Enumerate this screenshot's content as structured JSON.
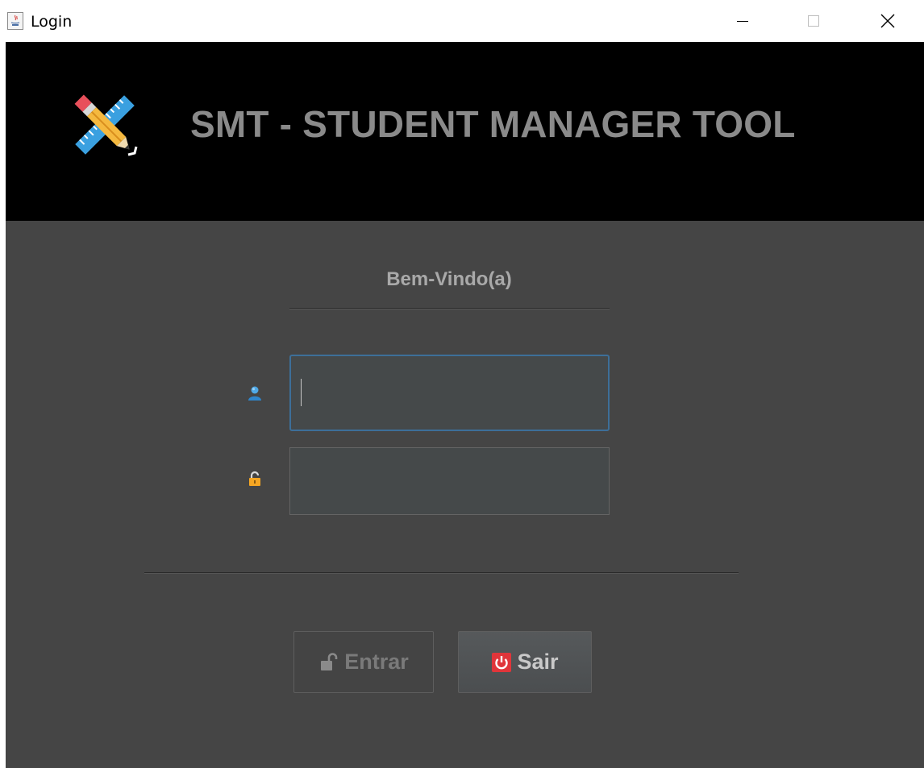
{
  "window": {
    "title": "Login",
    "controls": {
      "minimize_icon": "minimize-icon",
      "maximize_icon": "maximize-icon",
      "close_icon": "close-icon"
    }
  },
  "header": {
    "app_title": "SMT - STUDENT MANAGER TOOL",
    "logo_icon": "ruler-pencil-icon",
    "background": "#000000",
    "title_color": "#8a8a8a"
  },
  "form": {
    "welcome_text": "Bem-Vindo(a)",
    "username": {
      "icon": "user-icon",
      "value": "",
      "placeholder": ""
    },
    "password": {
      "icon": "lock-icon",
      "value": "",
      "placeholder": ""
    }
  },
  "buttons": {
    "enter_label": "Entrar",
    "enter_icon": "unlock-icon",
    "exit_label": "Sair",
    "exit_icon": "power-icon"
  },
  "colors": {
    "panel_background": "#454545",
    "focus_border": "#3d6f99",
    "power_icon_red": "#e0353a"
  }
}
